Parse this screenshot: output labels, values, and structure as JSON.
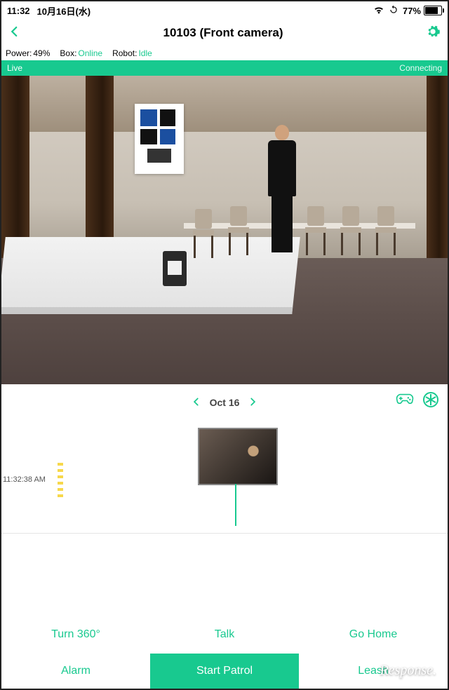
{
  "statusbar": {
    "time": "11:32",
    "date": "10月16日(水)",
    "battery_pct": "77%"
  },
  "nav": {
    "title": "10103 (Front camera)"
  },
  "status": {
    "power_label": "Power:",
    "power_value": "49%",
    "box_label": "Box:",
    "box_value": "Online",
    "robot_label": "Robot:",
    "robot_value": "Idle"
  },
  "livebar": {
    "left": "Live",
    "right": "Connecting"
  },
  "datebar": {
    "date": "Oct 16"
  },
  "timeline": {
    "timestamp": "11:32:38 AM"
  },
  "actions_row1": {
    "turn": "Turn 360°",
    "talk": "Talk",
    "gohome": "Go Home"
  },
  "actions_row2": {
    "alarm": "Alarm",
    "start_patrol": "Start Patrol",
    "leash": "Leash"
  },
  "watermark": "Response."
}
